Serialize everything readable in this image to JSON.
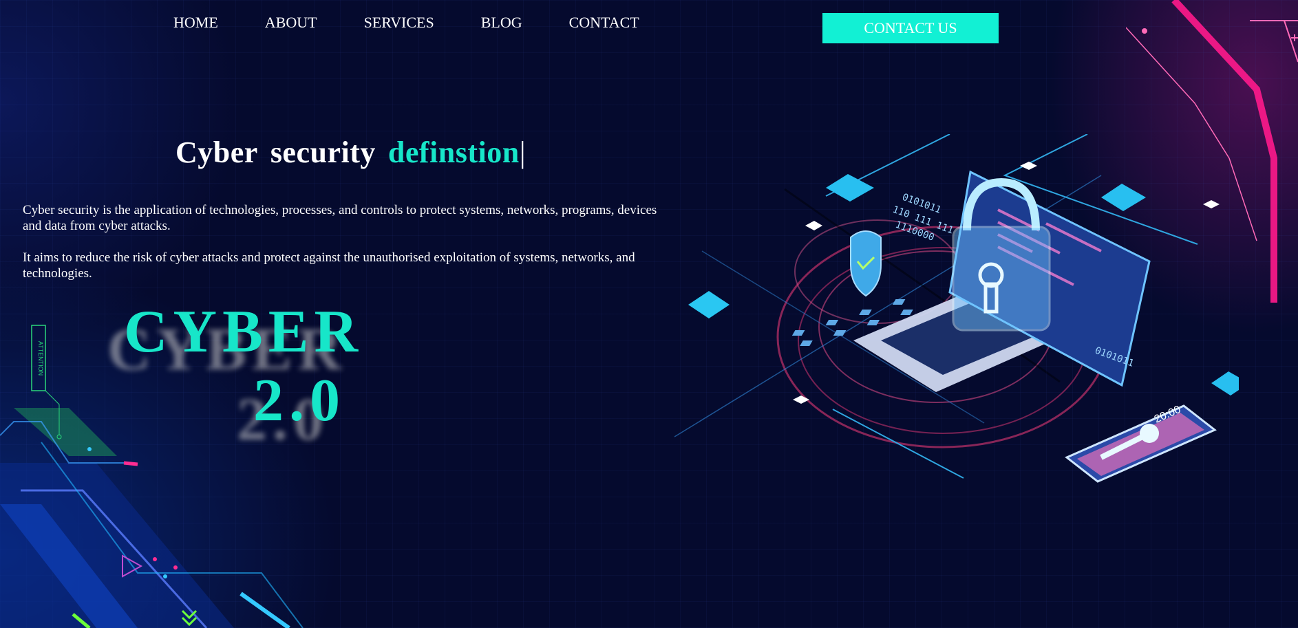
{
  "nav": {
    "items": [
      {
        "label": "HOME"
      },
      {
        "label": "ABOUT"
      },
      {
        "label": "SERVICES"
      },
      {
        "label": "BLOG"
      },
      {
        "label": "CONTACT"
      }
    ],
    "cta_label": "CONTACT US"
  },
  "hero": {
    "heading_word1": "Cyber",
    "heading_word2": "security",
    "heading_highlight": "definstion",
    "caret": "|",
    "paragraph1": "Cyber security is the application of technologies, processes, and controls to protect systems, networks, programs, devices and data from cyber attacks.",
    "paragraph2": "It aims to reduce the risk of cyber attacks and protect against the unauthorised exploitation of systems, networks, and technologies.",
    "big_title_line1": "CYBER",
    "big_title_line2": "2.0"
  },
  "illustration": {
    "binary_text_1": "0101011",
    "binary_text_2": "110 111 111",
    "binary_text_3": "1110000",
    "phone_time": "20:00",
    "attention_label": "ATTENTION"
  },
  "colors": {
    "accent": "#17e6c9",
    "cta_bg": "#12f0d4",
    "background": "#050a2e",
    "magenta": "#ff1a8c"
  }
}
